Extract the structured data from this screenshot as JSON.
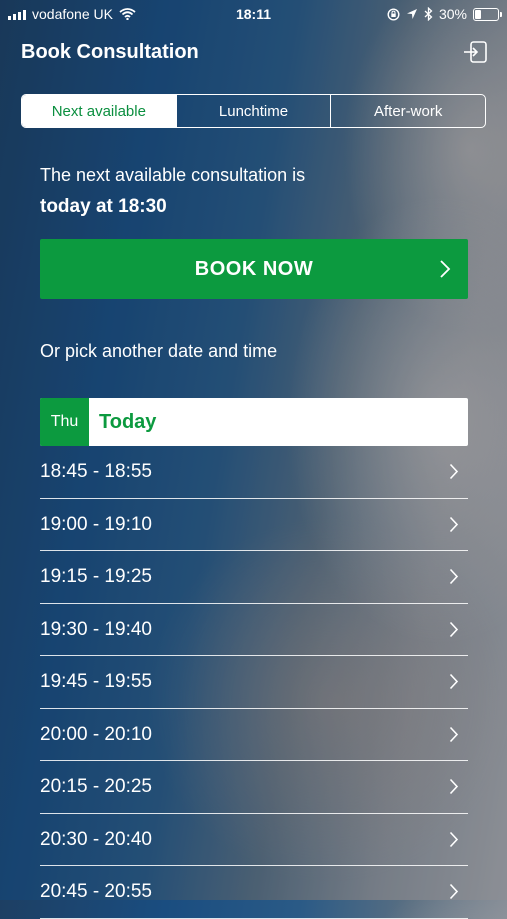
{
  "status_bar": {
    "carrier": "vodafone UK",
    "time": "18:11",
    "battery_percent": "30%",
    "battery_level": 0.3,
    "icons": [
      "signal-icon",
      "wifi-icon",
      "lock-rotation-icon",
      "location-icon",
      "bluetooth-icon",
      "battery-icon"
    ]
  },
  "header": {
    "title": "Book Consultation",
    "logout_icon": "logout-icon"
  },
  "tabs": [
    {
      "label": "Next available",
      "active": true
    },
    {
      "label": "Lunchtime",
      "active": false
    },
    {
      "label": "After-work",
      "active": false
    }
  ],
  "next_available": {
    "line1": "The next available consultation is",
    "line2": "today at 18:30"
  },
  "book_button": {
    "label": "BOOK NOW",
    "icon": "chevron-right-icon"
  },
  "pick_text": "Or pick another date and time",
  "day": {
    "abbrev": "Thu",
    "name": "Today"
  },
  "slots": [
    "18:45 - 18:55",
    "19:00 - 19:10",
    "19:15 - 19:25",
    "19:30 - 19:40",
    "19:45 - 19:55",
    "20:00 - 20:10",
    "20:15 - 20:25",
    "20:30 - 20:40",
    "20:45 - 20:55"
  ],
  "colors": {
    "accent_green": "#0c9a3f",
    "tab_active_text": "#0b8f3f",
    "text": "#ffffff"
  }
}
